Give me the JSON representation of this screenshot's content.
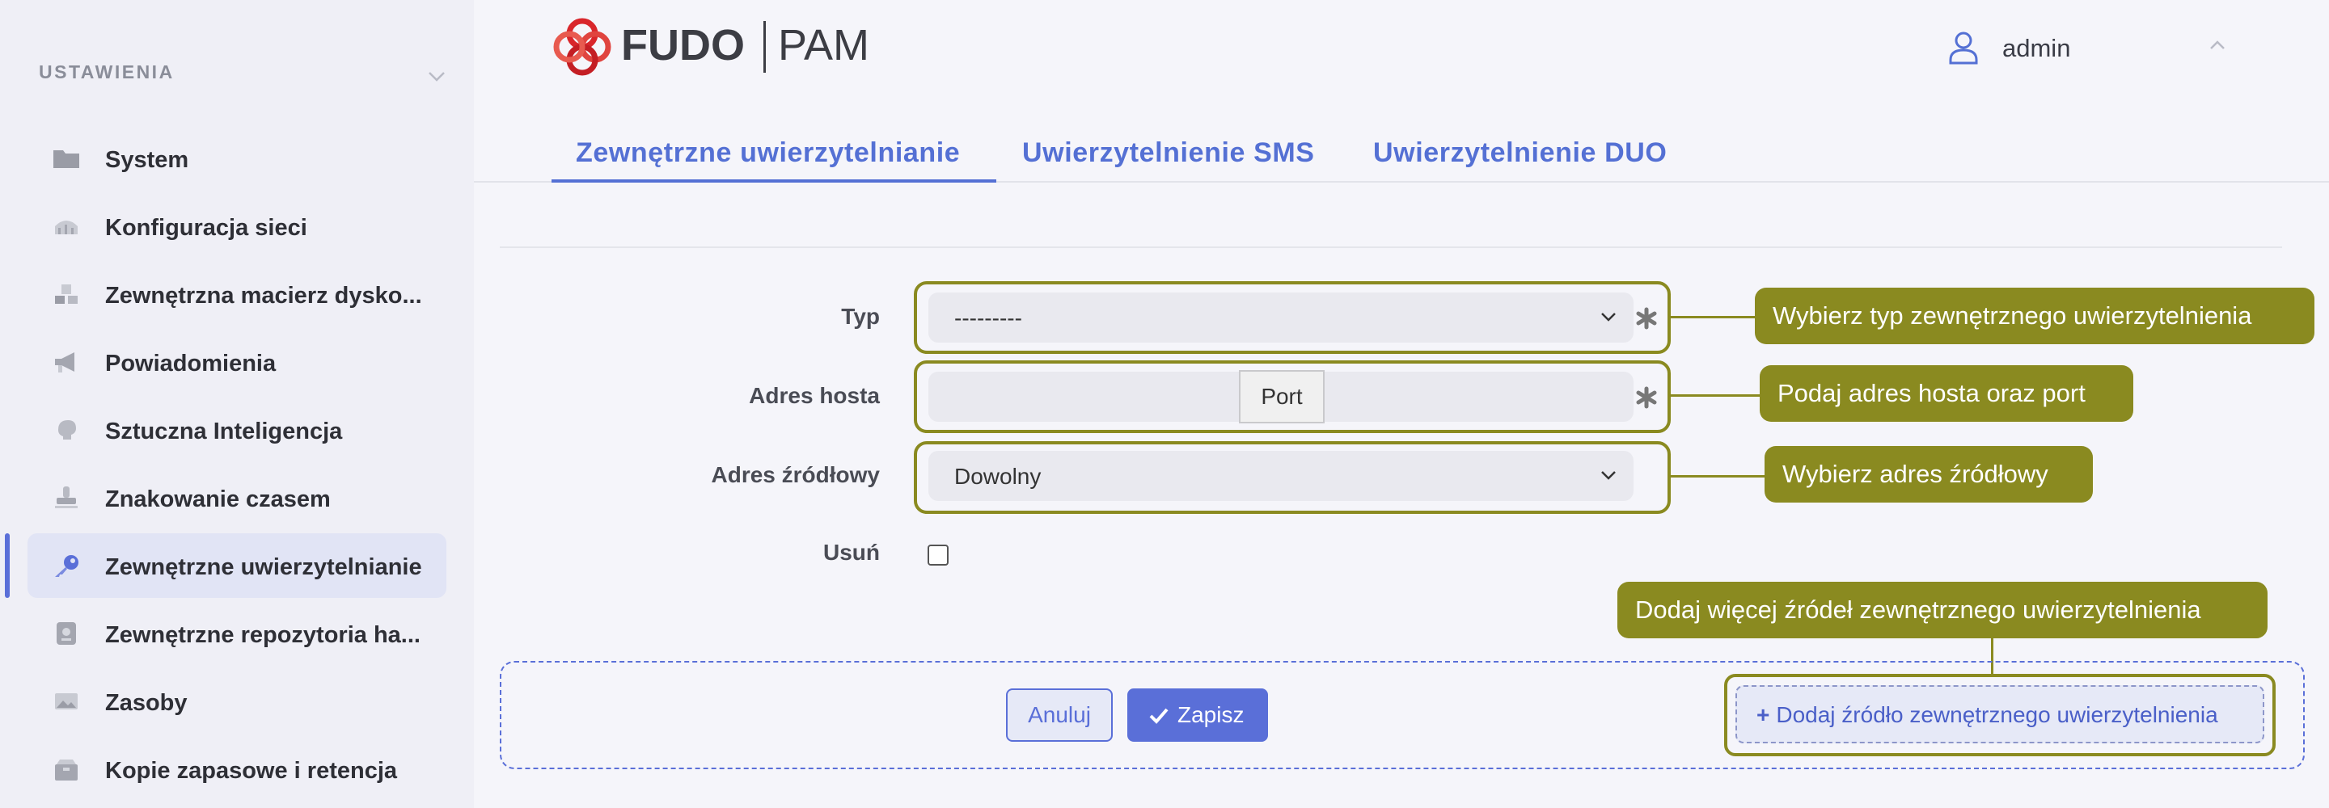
{
  "sidebar": {
    "heading": "USTAWIENIA",
    "items": [
      {
        "label": "System",
        "icon": "folder-icon"
      },
      {
        "label": "Konfiguracja sieci",
        "icon": "network-icon"
      },
      {
        "label": "Zewnętrzna macierz dysko...",
        "icon": "storage-icon"
      },
      {
        "label": "Powiadomienia",
        "icon": "megaphone-icon"
      },
      {
        "label": "Sztuczna Inteligencja",
        "icon": "brain-icon"
      },
      {
        "label": "Znakowanie czasem",
        "icon": "stamp-icon"
      },
      {
        "label": "Zewnętrzne uwierzytelnianie",
        "icon": "key-icon",
        "active": true
      },
      {
        "label": "Zewnętrzne repozytoria ha...",
        "icon": "vault-icon"
      },
      {
        "label": "Zasoby",
        "icon": "image-icon"
      },
      {
        "label": "Kopie zapasowe i retencja",
        "icon": "box-icon"
      }
    ]
  },
  "header": {
    "logo_brand": "FUDO",
    "logo_product": "PAM",
    "user": "admin"
  },
  "tabs": [
    {
      "label": "Zewnętrzne uwierzytelnianie",
      "active": true
    },
    {
      "label": "Uwierzytelnienie SMS"
    },
    {
      "label": "Uwierzytelnienie DUO"
    }
  ],
  "form": {
    "type_label": "Typ",
    "type_value": "---------",
    "host_label": "Adres hosta",
    "host_value": "",
    "port_placeholder": "Port",
    "source_label": "Adres źródłowy",
    "source_value": "Dowolny",
    "delete_label": "Usuń"
  },
  "callouts": {
    "type": "Wybierz typ zewnętrznego uwierzytelnienia",
    "host": "Podaj adres hosta oraz port",
    "source": "Wybierz adres źródłowy",
    "add": "Dodaj więcej źródeł zewnętrznego uwierzytelnienia"
  },
  "footer": {
    "cancel": "Anuluj",
    "save": "Zapisz",
    "add_source": "Dodaj źródło zewnętrznego uwierzytelnienia"
  },
  "colors": {
    "accent": "#5a6fd8",
    "callout": "#8a8a20",
    "sidebar_bg": "#efeff6",
    "logo_red": "#d9262b"
  }
}
